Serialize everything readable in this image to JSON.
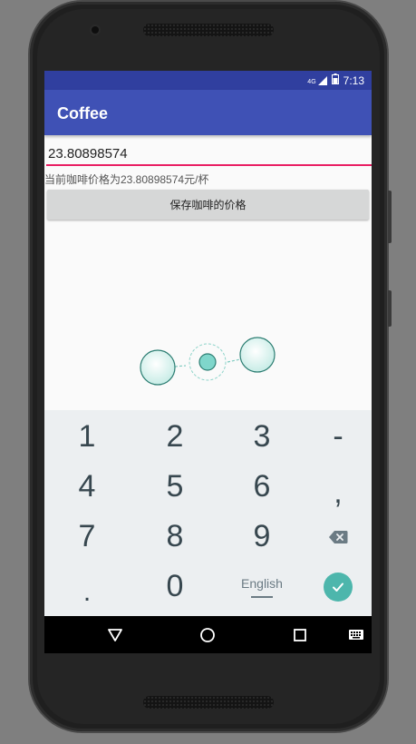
{
  "status_bar": {
    "network": "4G",
    "time": "7:13"
  },
  "app": {
    "title": "Coffee"
  },
  "form": {
    "price_value": "23.80898574",
    "current_price_text": "当前咖啡价格为23.80898574元/杯",
    "save_label": "保存咖啡的价格"
  },
  "keyboard": {
    "rows": [
      [
        "1",
        "2",
        "3",
        "-"
      ],
      [
        "4",
        "5",
        "6",
        ","
      ],
      [
        "7",
        "8",
        "9",
        "backspace-icon"
      ],
      [
        ".",
        "0",
        "English",
        "enter-check-icon"
      ]
    ],
    "language_label": "English"
  },
  "nav": {
    "buttons": [
      "back-icon",
      "home-icon",
      "recents-icon",
      "keyboard-switch-icon"
    ]
  },
  "colors": {
    "status_bar": "#303f9f",
    "app_bar": "#3f51b5",
    "input_underline": "#e91e63",
    "keyboard_bg": "#eceff1",
    "enter_key": "#4db6ac"
  }
}
